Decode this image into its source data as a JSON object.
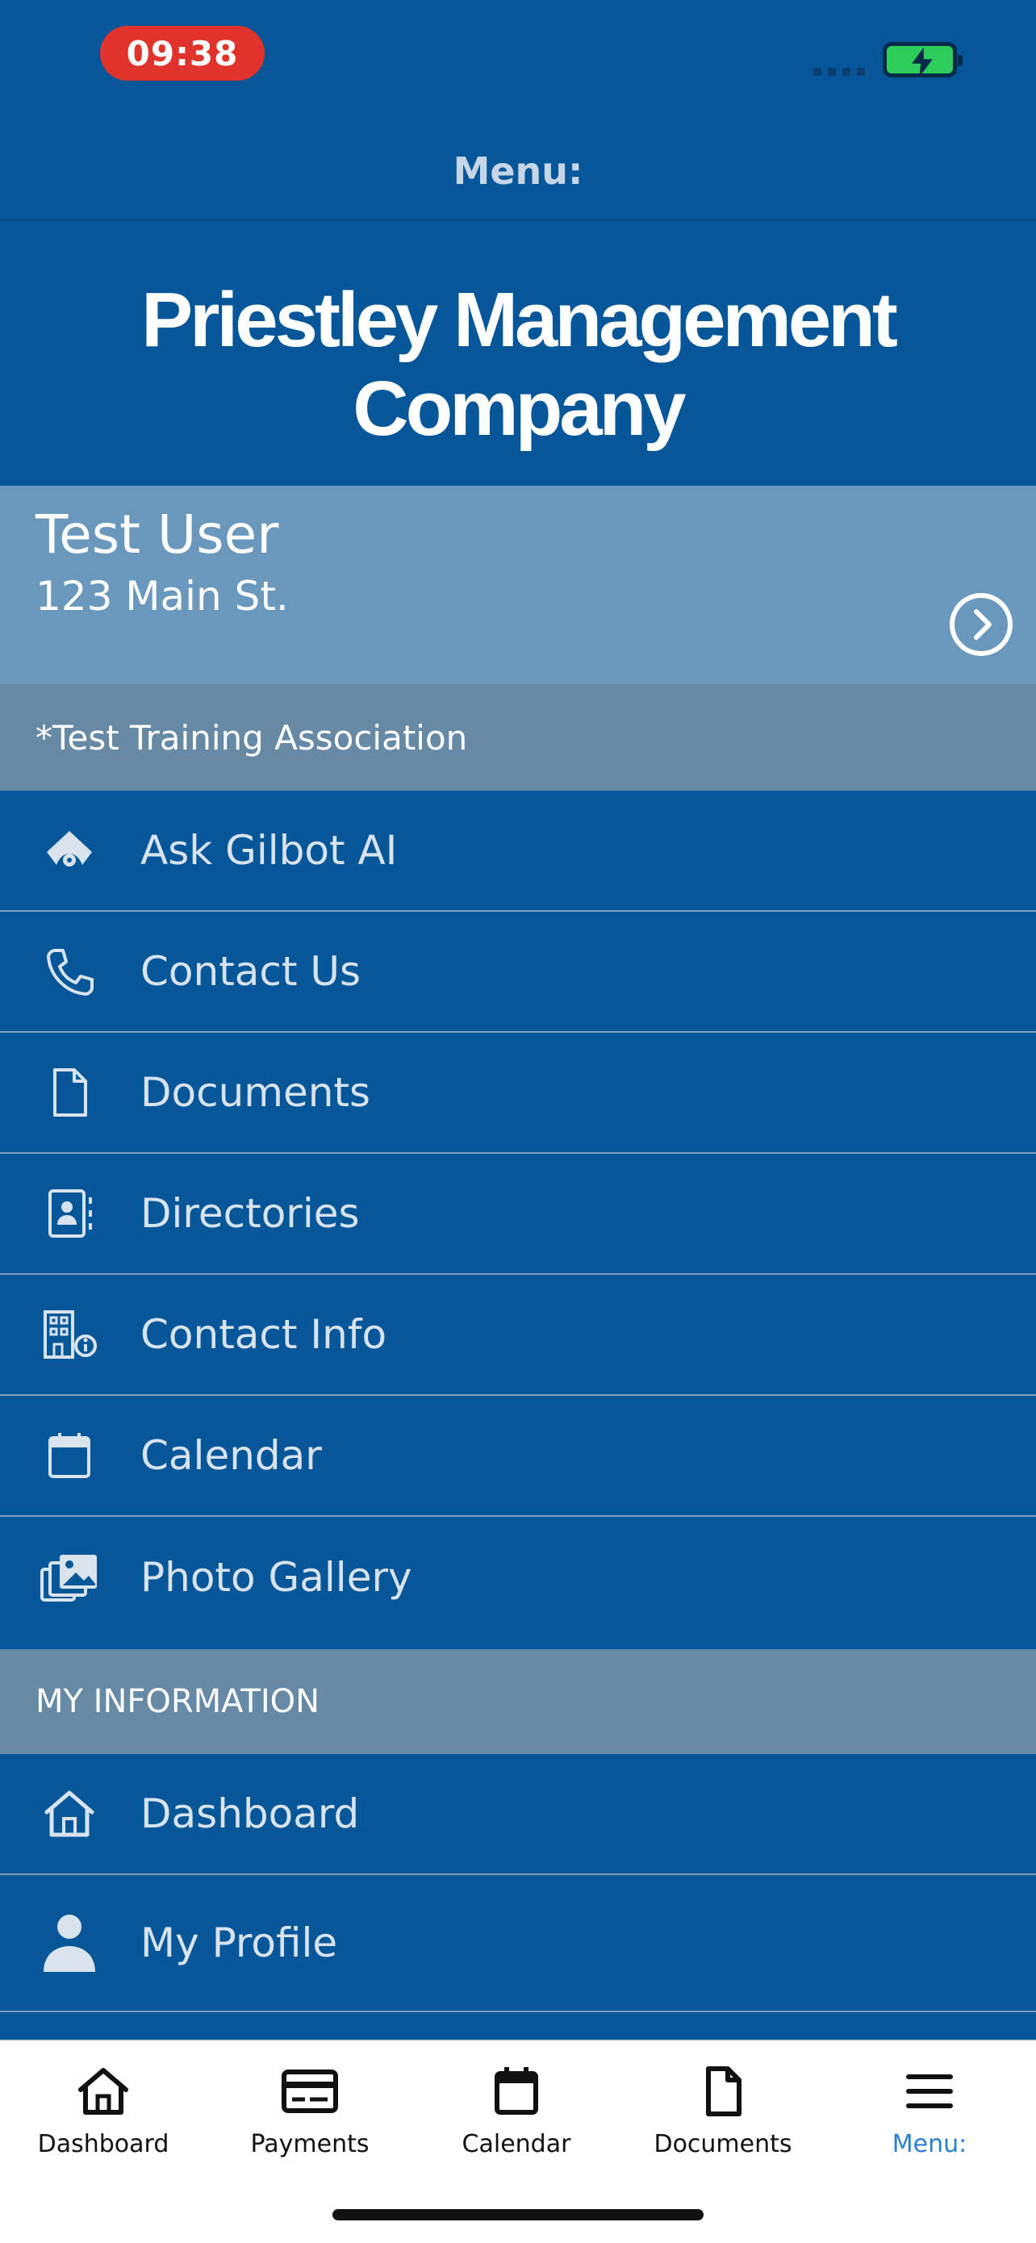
{
  "status": {
    "time": "09:38"
  },
  "header": {
    "title": "Menu:"
  },
  "company": {
    "name": "Priestley Management Company"
  },
  "user": {
    "name": "Test User",
    "address": "123 Main St."
  },
  "association": {
    "label": "*Test Training Association"
  },
  "menu_items": [
    {
      "label": "Ask Gilbot AI",
      "icon": "gilbot-icon"
    },
    {
      "label": "Contact Us",
      "icon": "phone-icon"
    },
    {
      "label": "Documents",
      "icon": "document-icon"
    },
    {
      "label": "Directories",
      "icon": "contact-book-icon"
    },
    {
      "label": "Contact Info",
      "icon": "building-info-icon"
    },
    {
      "label": "Calendar",
      "icon": "calendar-icon"
    },
    {
      "label": "Photo Gallery",
      "icon": "photo-gallery-icon"
    }
  ],
  "my_information": {
    "heading": "MY INFORMATION",
    "items": [
      {
        "label": "Dashboard",
        "icon": "home-icon"
      },
      {
        "label": "My Profile",
        "icon": "person-icon"
      }
    ]
  },
  "tabs": [
    {
      "label": "Dashboard",
      "icon": "home-icon"
    },
    {
      "label": "Payments",
      "icon": "payment-card-icon"
    },
    {
      "label": "Calendar",
      "icon": "calendar-icon"
    },
    {
      "label": "Documents",
      "icon": "document-icon"
    },
    {
      "label": "Menu:",
      "icon": "hamburger-icon",
      "active": true
    }
  ],
  "colors": {
    "background": "#06569a",
    "user_card": "#6a98bd",
    "section_bar": "#6689a6",
    "time_pill": "#e0332b",
    "active_tab": "#2a7fd4"
  }
}
